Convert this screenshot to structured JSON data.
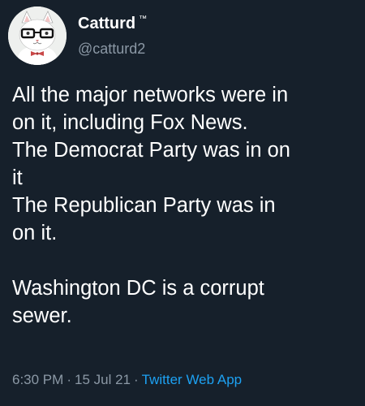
{
  "tweet": {
    "display_name": "Catturd",
    "tm_mark": "™",
    "handle": "@catturd2",
    "text": "All the major networks were in\non it, including Fox News.\nThe Democrat Party was in on\nit\nThe Republican Party was in\non it.\n\nWashington DC is a corrupt\nsewer.",
    "time": "6:30 PM",
    "separator1": "·",
    "date": "15 Jul 21",
    "separator2": "·",
    "client": "Twitter Web App"
  },
  "colors": {
    "background": "#16202b",
    "text_primary": "#ffffff",
    "text_secondary": "#8b98a5",
    "link": "#1da1f2"
  },
  "icons": {
    "avatar": "cat-with-glasses-avatar"
  }
}
